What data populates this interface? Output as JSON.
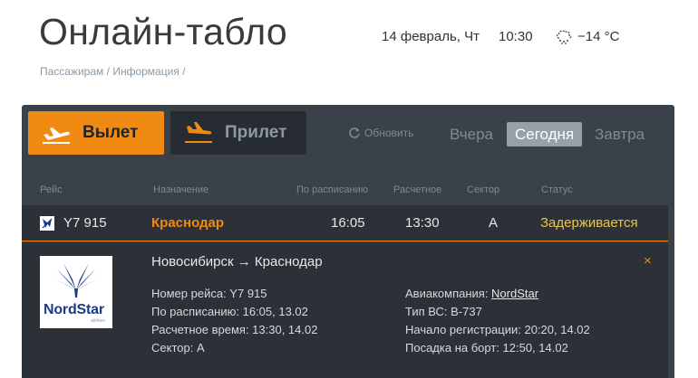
{
  "header": {
    "title": "Онлайн-табло",
    "date": "14 февраль, Чт",
    "time": "10:30",
    "weather_icon": "cloud-snow-icon",
    "temperature": "−14 °C"
  },
  "breadcrumb": {
    "item1": "Пассажирам",
    "sep1": " / ",
    "item2": "Информация",
    "sep2": " /"
  },
  "board": {
    "tabs": {
      "departure": "Вылет",
      "arrival": "Прилет"
    },
    "refresh": "Обновить",
    "days": {
      "yesterday": "Вчера",
      "today": "Сегодня",
      "tomorrow": "Завтра"
    },
    "columns": {
      "flight": "Рейс",
      "destination": "Назначение",
      "scheduled": "По расписанию",
      "estimated": "Расчетное",
      "sector": "Сектор",
      "status": "Статус"
    },
    "flight": {
      "number": "Y7 915",
      "destination": "Краснодар",
      "scheduled": "16:05",
      "estimated": "13:30",
      "sector": "A",
      "status": "Задерживается"
    },
    "details": {
      "route": "Новосибирск → Краснодар",
      "close": "×",
      "airline_logo_text": "NordStar",
      "airline_logo_sub": "airlines",
      "flight_number": "Номер рейса: Y7 915",
      "scheduled": "По расписанию: 16:05, 13.02",
      "estimated": "Расчетное время: 13:30, 14.02",
      "sector": "Сектор: A",
      "airline_label": "Авиакомпания: ",
      "airline_name": "NordStar",
      "aircraft": "Тип ВС: B-737",
      "checkin": "Начало регистрации: 20:20, 14.02",
      "boarding": "Посадка на борт: 12:50, 14.02"
    }
  },
  "colors": {
    "accent": "#f08a12",
    "board_bg": "#3a4149",
    "row_bg": "#2b3137",
    "status_delayed": "#e8c54d"
  }
}
